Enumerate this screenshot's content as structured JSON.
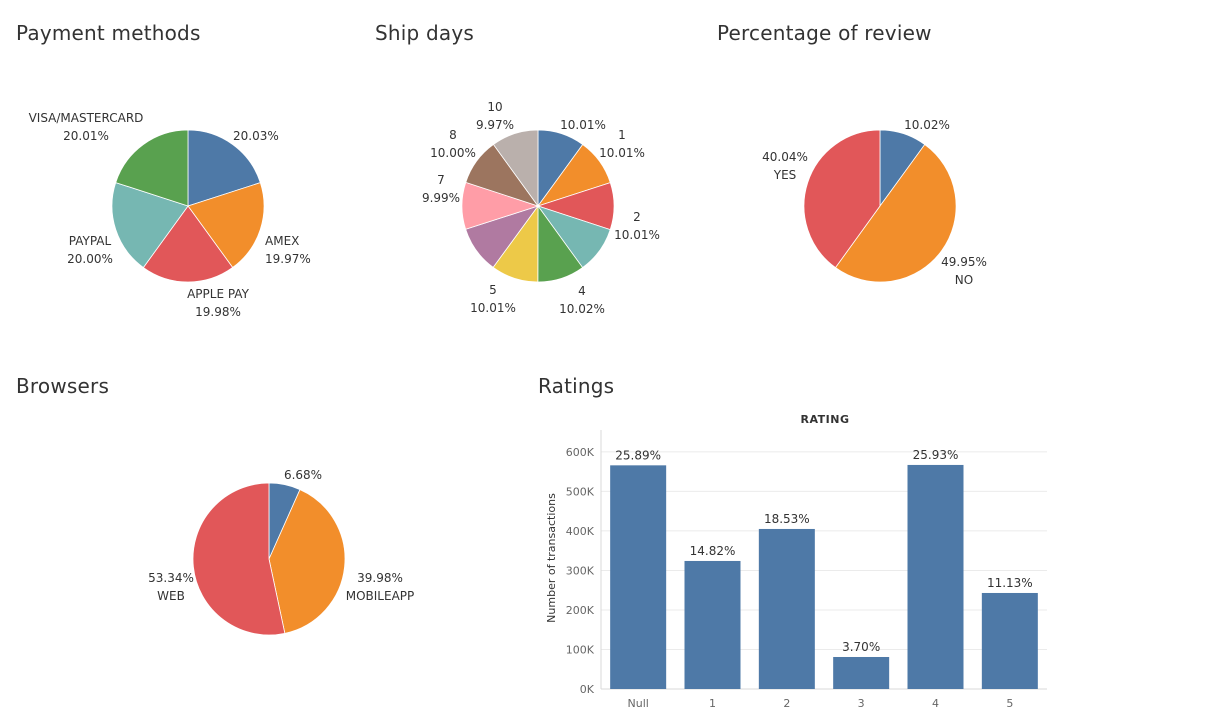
{
  "chart_data": [
    {
      "type": "pie",
      "title": "Payment methods",
      "slices": [
        {
          "name": "",
          "percent": "20.03%",
          "value": 20.03,
          "color": "#4E79A7"
        },
        {
          "name": "AMEX",
          "percent": "19.97%",
          "value": 19.97,
          "color": "#F28E2B"
        },
        {
          "name": "APPLE PAY",
          "percent": "19.98%",
          "value": 19.98,
          "color": "#E15759"
        },
        {
          "name": "PAYPAL",
          "percent": "20.00%",
          "value": 20.0,
          "color": "#76B7B2"
        },
        {
          "name": "VISA/MASTERCARD",
          "percent": "20.01%",
          "value": 20.01,
          "color": "#59A14F"
        }
      ]
    },
    {
      "type": "pie",
      "title": "Ship days",
      "slices": [
        {
          "name": "",
          "percent": "10.01%",
          "value": 10.01,
          "color": "#4E79A7"
        },
        {
          "name": "1",
          "percent": "10.01%",
          "value": 10.01,
          "color": "#F28E2B"
        },
        {
          "name": "2",
          "percent": "10.01%",
          "value": 10.01,
          "color": "#E15759"
        },
        {
          "name": "",
          "percent": "",
          "value": 10.0,
          "color": "#76B7B2"
        },
        {
          "name": "4",
          "percent": "10.02%",
          "value": 10.02,
          "color": "#59A14F"
        },
        {
          "name": "5",
          "percent": "10.01%",
          "value": 10.01,
          "color": "#EDC948"
        },
        {
          "name": "",
          "percent": "",
          "value": 10.0,
          "color": "#B07AA1"
        },
        {
          "name": "7",
          "percent": "9.99%",
          "value": 9.99,
          "color": "#FF9DA7"
        },
        {
          "name": "8",
          "percent": "10.00%",
          "value": 10.0,
          "color": "#9C755F"
        },
        {
          "name": "10",
          "percent": "9.97%",
          "value": 9.97,
          "color": "#BAB0AC"
        }
      ]
    },
    {
      "type": "pie",
      "title": "Percentage of review",
      "slices": [
        {
          "name": "",
          "percent": "10.02%",
          "value": 10.02,
          "color": "#4E79A7"
        },
        {
          "name": "NO",
          "percent": "49.95%",
          "value": 49.95,
          "color": "#F28E2B"
        },
        {
          "name": "YES",
          "percent": "40.04%",
          "value": 40.04,
          "color": "#E15759"
        }
      ]
    },
    {
      "type": "pie",
      "title": "Browsers",
      "slices": [
        {
          "name": "",
          "percent": "6.68%",
          "value": 6.68,
          "color": "#4E79A7"
        },
        {
          "name": "MOBILEAPP",
          "percent": "39.98%",
          "value": 39.98,
          "color": "#F28E2B"
        },
        {
          "name": "WEB",
          "percent": "53.34%",
          "value": 53.34,
          "color": "#E15759"
        }
      ]
    },
    {
      "type": "bar",
      "title": "Ratings",
      "subtitle": "RATING",
      "ylabel": "Number of transactions",
      "categories": [
        "Null",
        "1",
        "2",
        "3",
        "4",
        "5"
      ],
      "values": [
        566000,
        324000,
        405000,
        81000,
        567000,
        243000
      ],
      "data_labels": [
        "25.89%",
        "14.82%",
        "18.53%",
        "3.70%",
        "25.93%",
        "11.13%"
      ],
      "yticks": [
        0,
        100000,
        200000,
        300000,
        400000,
        500000,
        600000
      ],
      "ytick_labels": [
        "0K",
        "100K",
        "200K",
        "300K",
        "400K",
        "500K",
        "600K"
      ],
      "ylim": [
        0,
        620000
      ],
      "color": "#4E79A7",
      "grid": true
    }
  ]
}
